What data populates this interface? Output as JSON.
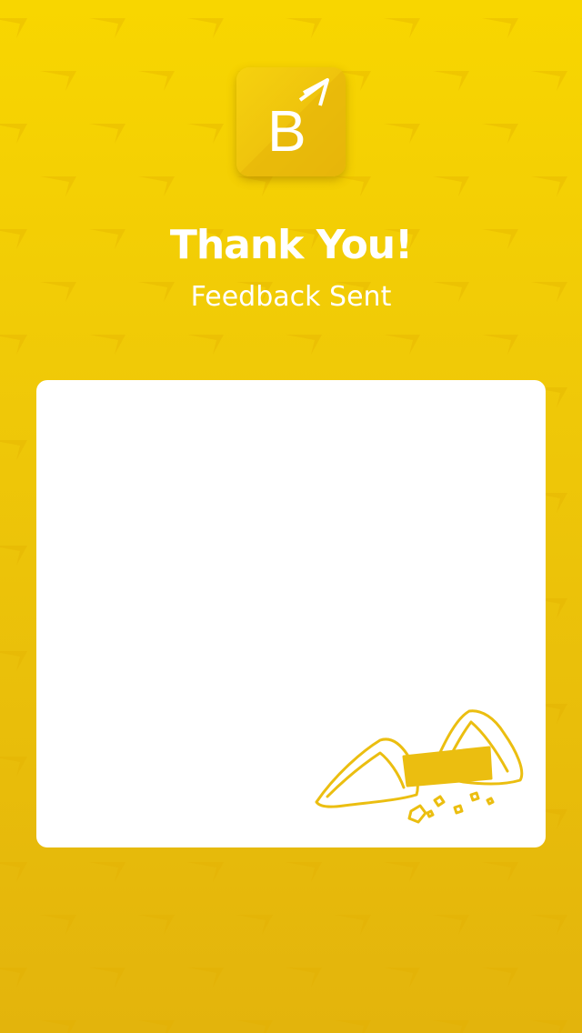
{
  "colors": {
    "background_top": "#F8D600",
    "background_bottom": "#E3B40C",
    "text": "#FFFFFF",
    "card": "#FFFFFF",
    "accent": "#EBBE10"
  },
  "app": {
    "logo_icon": "brand-b-logo-icon"
  },
  "header": {
    "title": "Thank You!",
    "subtitle": "Feedback Sent"
  },
  "card": {
    "illustration_icon": "fortune-cookie-icon"
  }
}
